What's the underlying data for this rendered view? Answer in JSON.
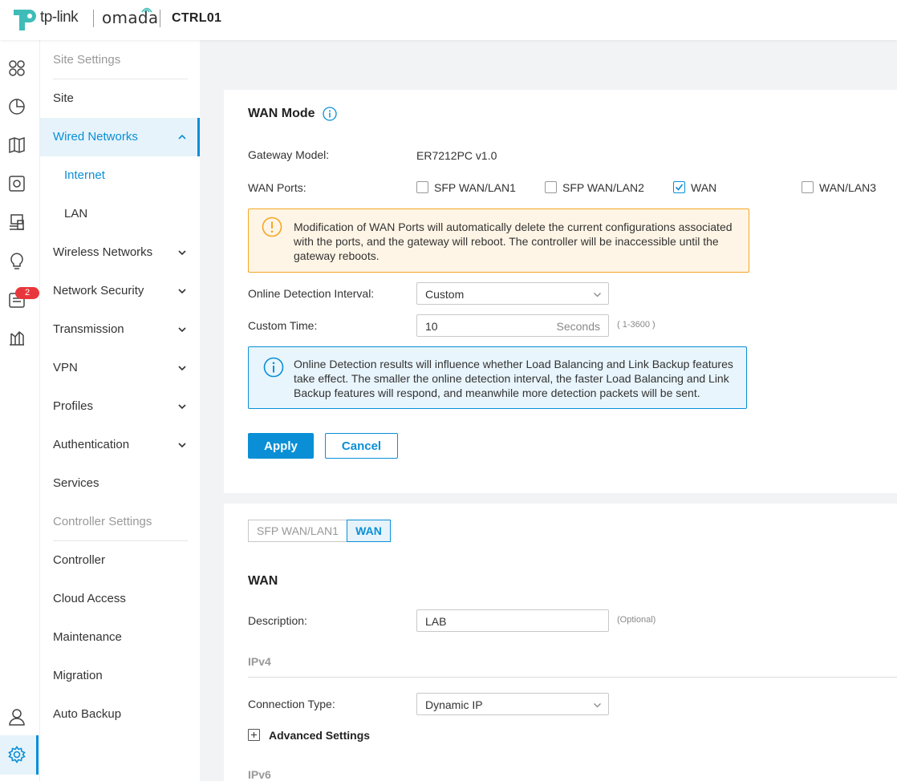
{
  "header": {
    "brand": "tp-link",
    "product": "omada",
    "site_name": "CTRL01"
  },
  "rail": {
    "icons": [
      "dashboard-icon",
      "statistics-icon",
      "map-icon",
      "devices-icon",
      "clients-icon",
      "insight-icon",
      "log-icon",
      "reports-icon",
      "account-icon",
      "settings-icon"
    ],
    "log_badge": "2"
  },
  "nav": {
    "site_settings_heading": "Site Settings",
    "items": [
      {
        "label": "Site"
      },
      {
        "label": "Wired Networks"
      },
      {
        "label": "Internet"
      },
      {
        "label": "LAN"
      },
      {
        "label": "Wireless Networks"
      },
      {
        "label": "Network Security"
      },
      {
        "label": "Transmission"
      },
      {
        "label": "VPN"
      },
      {
        "label": "Profiles"
      },
      {
        "label": "Authentication"
      },
      {
        "label": "Services"
      }
    ],
    "controller_settings_heading": "Controller Settings",
    "controller_items": [
      {
        "label": "Controller"
      },
      {
        "label": "Cloud Access"
      },
      {
        "label": "Maintenance"
      },
      {
        "label": "Migration"
      },
      {
        "label": "Auto Backup"
      }
    ]
  },
  "wan_mode": {
    "title": "WAN Mode",
    "gateway_model_label": "Gateway Model:",
    "gateway_model_value": "ER7212PC v1.0",
    "wan_ports_label": "WAN Ports:",
    "ports": [
      {
        "label": "SFP WAN/LAN1",
        "checked": false
      },
      {
        "label": "SFP WAN/LAN2",
        "checked": false
      },
      {
        "label": "WAN",
        "checked": true
      },
      {
        "label": "WAN/LAN3",
        "checked": false
      }
    ],
    "warning": "Modification of WAN Ports will automatically delete the current configurations associated with the ports, and the gateway will reboot. The controller will be inaccessible until the gateway reboots.",
    "interval_label": "Online Detection Interval:",
    "interval_value": "Custom",
    "custom_time_label": "Custom Time:",
    "custom_time_value": "10",
    "custom_time_unit": "Seconds",
    "custom_time_range": "( 1-3600 )",
    "info": "Online Detection results will influence whether Load Balancing and Link Backup features take effect. The smaller the online detection interval, the faster Load Balancing and Link Backup features will respond, and meanwhile more detection packets will be sent.",
    "apply_label": "Apply",
    "cancel_label": "Cancel"
  },
  "wan_config": {
    "tabs": [
      "SFP WAN/LAN1",
      "WAN"
    ],
    "title": "WAN",
    "description_label": "Description:",
    "description_value": "LAB",
    "description_hint": "(Optional)",
    "ipv4_title": "IPv4",
    "connection_type_label": "Connection Type:",
    "connection_type_value": "Dynamic IP",
    "advanced_label": "Advanced Settings",
    "ipv6_title": "IPv6"
  },
  "colors": {
    "accent": "#0a8fd6",
    "warning": "#f5a623",
    "badge": "#e8373c"
  }
}
